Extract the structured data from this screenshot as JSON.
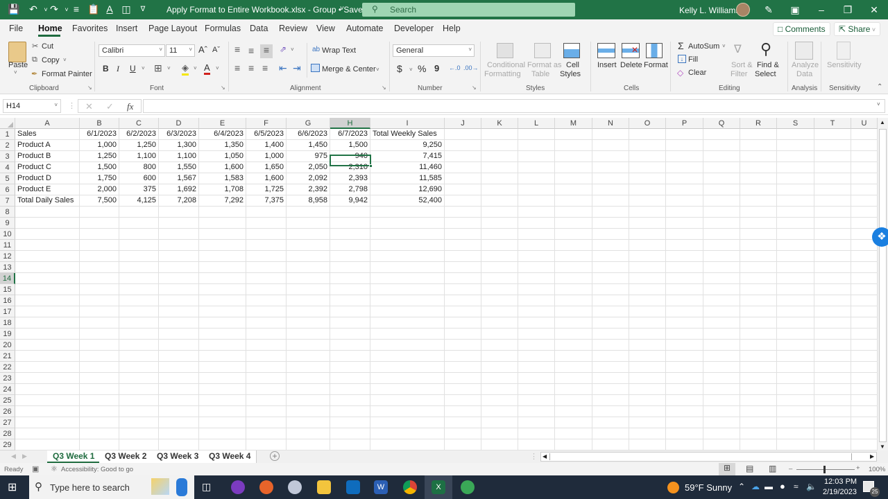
{
  "titlebar": {
    "doc_title": "Apply Format to Entire Workbook.xlsx  -  Group • Saved",
    "search_placeholder": "Search",
    "user_name": "Kelly L. Williams",
    "quick_access": [
      "save-icon",
      "undo-icon",
      "redo-icon",
      "list-icon",
      "clipboard-icon",
      "font-color-icon",
      "screen-icon",
      "customize-icon"
    ]
  },
  "menu": {
    "tabs": [
      "File",
      "Home",
      "Favorites",
      "Insert",
      "Page Layout",
      "Formulas",
      "Data",
      "Review",
      "View",
      "Automate",
      "Developer",
      "Help"
    ],
    "active_tab": "Home",
    "comments_label": "Comments",
    "share_label": "Share"
  },
  "ribbon": {
    "clipboard": {
      "paste": "Paste",
      "cut": "Cut",
      "copy": "Copy",
      "format_painter": "Format Painter",
      "group": "Clipboard"
    },
    "font": {
      "font_name": "Calibri",
      "font_size": "11",
      "bold": "B",
      "italic": "I",
      "underline": "U",
      "group": "Font"
    },
    "alignment": {
      "wrap_text": "Wrap Text",
      "merge_center": "Merge & Center",
      "group": "Alignment"
    },
    "number": {
      "format": "General",
      "currency": "$",
      "percent": "%",
      "comma": "9",
      "group": "Number"
    },
    "styles": {
      "conditional": "Conditional",
      "conditional2": "Formatting",
      "format_table": "Format as",
      "format_table2": "Table",
      "cell_styles": "Cell",
      "cell_styles2": "Styles",
      "group": "Styles"
    },
    "cells": {
      "insert": "Insert",
      "delete": "Delete",
      "format": "Format",
      "group": "Cells"
    },
    "editing": {
      "autosum": "AutoSum",
      "fill": "Fill",
      "clear": "Clear",
      "sort": "Sort &",
      "sort2": "Filter",
      "find": "Find &",
      "find2": "Select",
      "group": "Editing"
    },
    "analysis": {
      "analyze": "Analyze",
      "analyze2": "Data",
      "group": "Analysis"
    },
    "sensitivity": {
      "label": "Sensitivity",
      "group": "Sensitivity"
    }
  },
  "formula_bar": {
    "name_box": "H14",
    "formula": "",
    "fx": "fx"
  },
  "sheet": {
    "columns": [
      "A",
      "B",
      "C",
      "D",
      "E",
      "F",
      "G",
      "H",
      "I",
      "J",
      "K",
      "L",
      "M",
      "N",
      "O",
      "P",
      "Q",
      "R",
      "S",
      "T",
      "U"
    ],
    "selected_column": "H",
    "selected_row": 14,
    "selected_cell": "H14",
    "row_count": 29,
    "header_row": [
      "Sales",
      "6/1/2023",
      "6/2/2023",
      "6/3/2023",
      "6/4/2023",
      "6/5/2023",
      "6/6/2023",
      "6/7/2023",
      "Total Weekly Sales"
    ],
    "rows": [
      [
        "Product A",
        "1,000",
        "1,250",
        "1,300",
        "1,350",
        "1,400",
        "1,450",
        "1,500",
        "9,250"
      ],
      [
        "Product B",
        "1,250",
        "1,100",
        "1,100",
        "1,050",
        "1,000",
        "975",
        "940",
        "7,415"
      ],
      [
        "Product C",
        "1,500",
        "800",
        "1,550",
        "1,600",
        "1,650",
        "2,050",
        "2,310",
        "11,460"
      ],
      [
        "Product D",
        "1,750",
        "600",
        "1,567",
        "1,583",
        "1,600",
        "2,092",
        "2,393",
        "11,585"
      ],
      [
        "Product E",
        "2,000",
        "375",
        "1,692",
        "1,708",
        "1,725",
        "2,392",
        "2,798",
        "12,690"
      ],
      [
        "Total Daily Sales",
        "7,500",
        "4,125",
        "7,208",
        "7,292",
        "7,375",
        "8,958",
        "9,942",
        "52,400"
      ]
    ]
  },
  "sheet_tabs": [
    "Q3 Week 1",
    "Q3 Week 2",
    "Q3 Week 3",
    "Q3 Week 4"
  ],
  "active_sheet": "Q3 Week 1",
  "status": {
    "ready": "Ready",
    "accessibility": "Accessibility: Good to go",
    "zoom": "100%"
  },
  "taskbar": {
    "search_placeholder": "Type here to search",
    "weather": "59°F  Sunny",
    "time": "12:03 PM",
    "date": "2/19/2023",
    "notifications": "25"
  },
  "colors": {
    "excel_green": "#217346",
    "title_bar": "#217346",
    "taskbar": "#1f2b3b"
  }
}
